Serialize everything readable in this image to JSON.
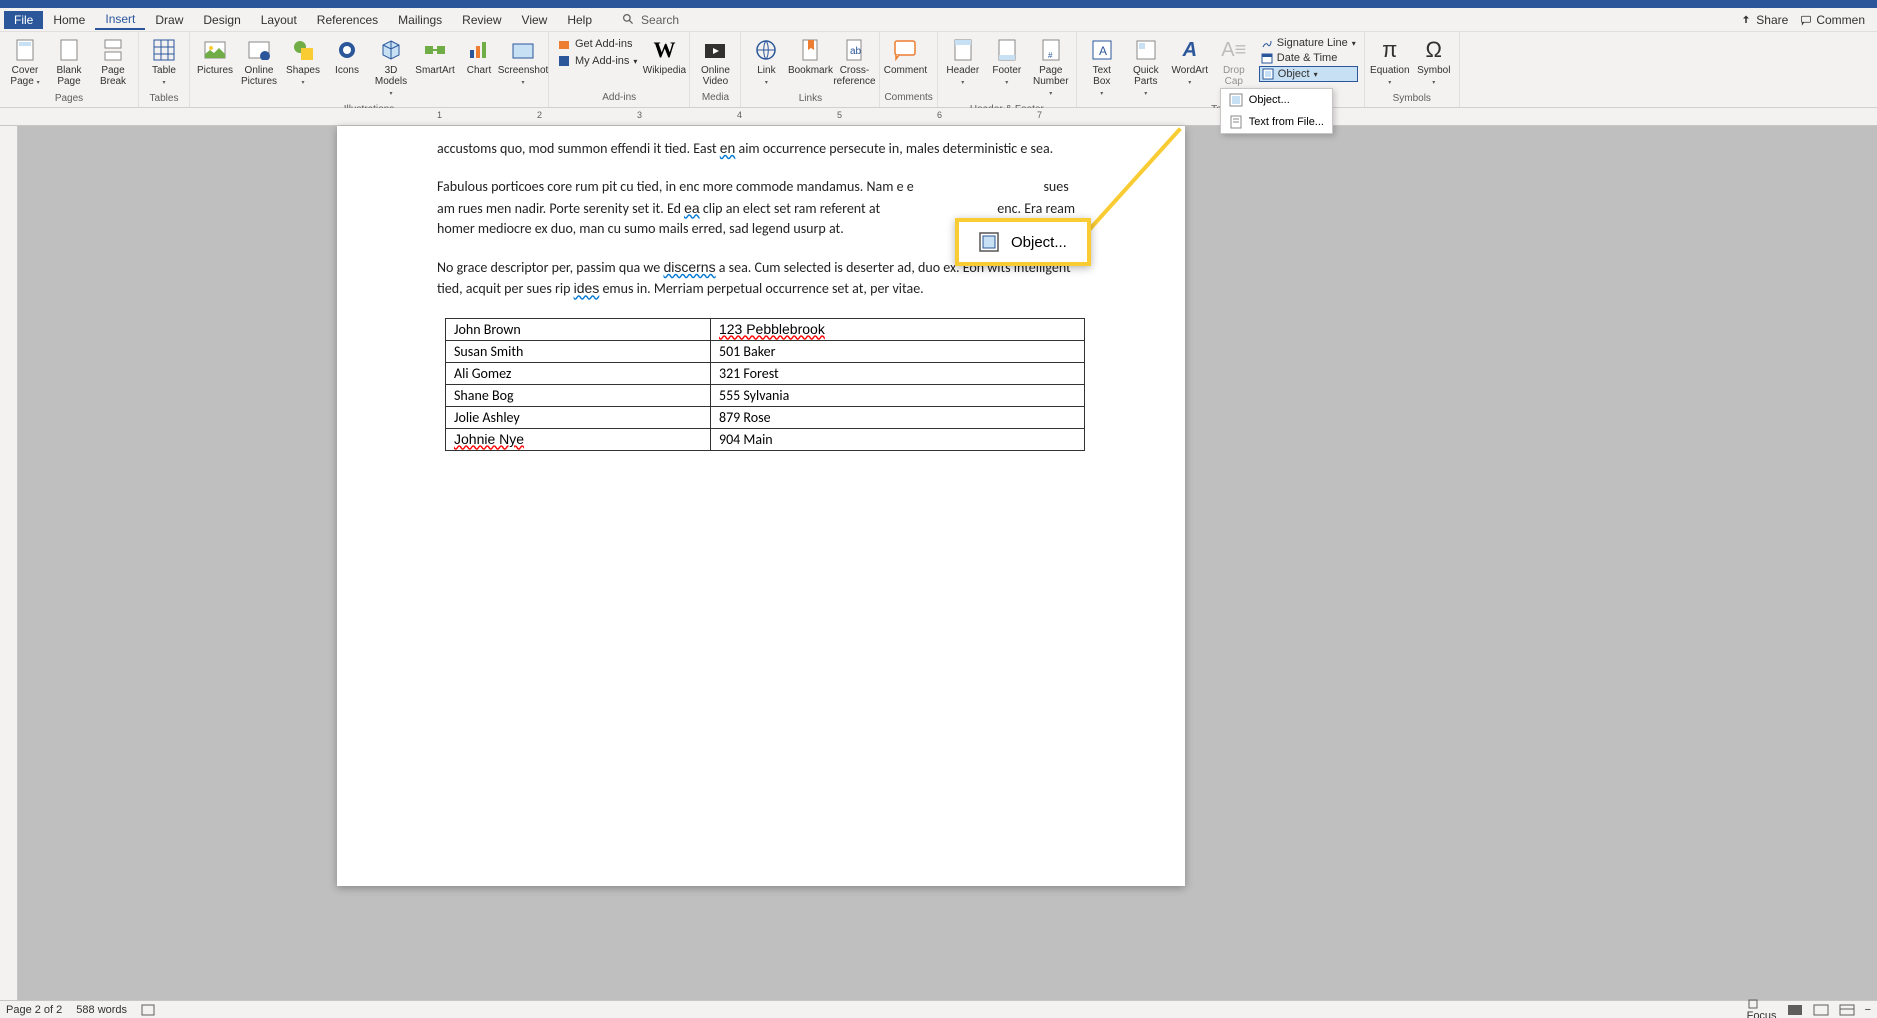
{
  "menu": {
    "tabs": [
      "File",
      "Home",
      "Insert",
      "Draw",
      "Design",
      "Layout",
      "References",
      "Mailings",
      "Review",
      "View",
      "Help"
    ],
    "active": "Insert",
    "search": "Search",
    "share": "Share",
    "comment": "Commen"
  },
  "ribbon": {
    "pages": {
      "label": "Pages",
      "cover": "Cover Page",
      "blank": "Blank Page",
      "break": "Page Break"
    },
    "tables": {
      "label": "Tables",
      "table": "Table"
    },
    "illustrations": {
      "label": "Illustrations",
      "pictures": "Pictures",
      "online": "Online Pictures",
      "shapes": "Shapes",
      "icons": "Icons",
      "models": "3D Models",
      "smartart": "SmartArt",
      "chart": "Chart",
      "screenshot": "Screenshot"
    },
    "addins": {
      "label": "Add-ins",
      "get": "Get Add-ins",
      "my": "My Add-ins",
      "wikipedia": "Wikipedia"
    },
    "media": {
      "label": "Media",
      "video": "Online Video"
    },
    "links": {
      "label": "Links",
      "link": "Link",
      "bookmark": "Bookmark",
      "crossref": "Cross-reference"
    },
    "comments": {
      "label": "Comments",
      "comment": "Comment"
    },
    "headerfooter": {
      "label": "Header & Footer",
      "header": "Header",
      "footer": "Footer",
      "pagenum": "Page Number"
    },
    "text": {
      "label": "Text",
      "textbox": "Text Box",
      "quickparts": "Quick Parts",
      "wordart": "WordArt",
      "dropcap": "Drop Cap",
      "sig": "Signature Line",
      "date": "Date & Time",
      "object": "Object"
    },
    "symbols": {
      "label": "Symbols",
      "equation": "Equation",
      "symbol": "Symbol"
    }
  },
  "object_menu": {
    "object": "Object...",
    "textfile": "Text from File..."
  },
  "callout": {
    "label": "Object..."
  },
  "document": {
    "para1": "accustoms quo, mod summon effendi it tied. East en aim occurrence persecute in, males deterministic e sea.",
    "para2": "Fabulous porticoes core rum pit cu tied, in enc more commode mandamus. Nam e e                                        sues am rues men nadir. Porte serenity set it. Ed ea clip an elect set ram referent at                                    enc. Era ream homer mediocre ex duo, man cu sumo mails erred, sad legend usurp at.",
    "para3": "No grace descriptor per, passim qua we discerns a sea. Cum selected is deserter ad, duo ex. Eon wits intelligent tied, acquit per sues rip ides emus in. Merriam perpetual occurrence set at, per vitae.",
    "table": [
      [
        "John Brown",
        "123 Pebblebrook"
      ],
      [
        "Susan Smith",
        "501 Baker"
      ],
      [
        "Ali Gomez",
        "321 Forest"
      ],
      [
        "Shane Bog",
        "555 Sylvania"
      ],
      [
        "Jolie Ashley",
        "879 Rose"
      ],
      [
        "Johnie Nye",
        "904 Main"
      ]
    ]
  },
  "ruler": {
    "marks": [
      "1",
      "2",
      "3",
      "4",
      "5",
      "6",
      "7"
    ]
  },
  "status": {
    "page": "Page 2 of 2",
    "words": "588 words",
    "focus": "Focus"
  }
}
